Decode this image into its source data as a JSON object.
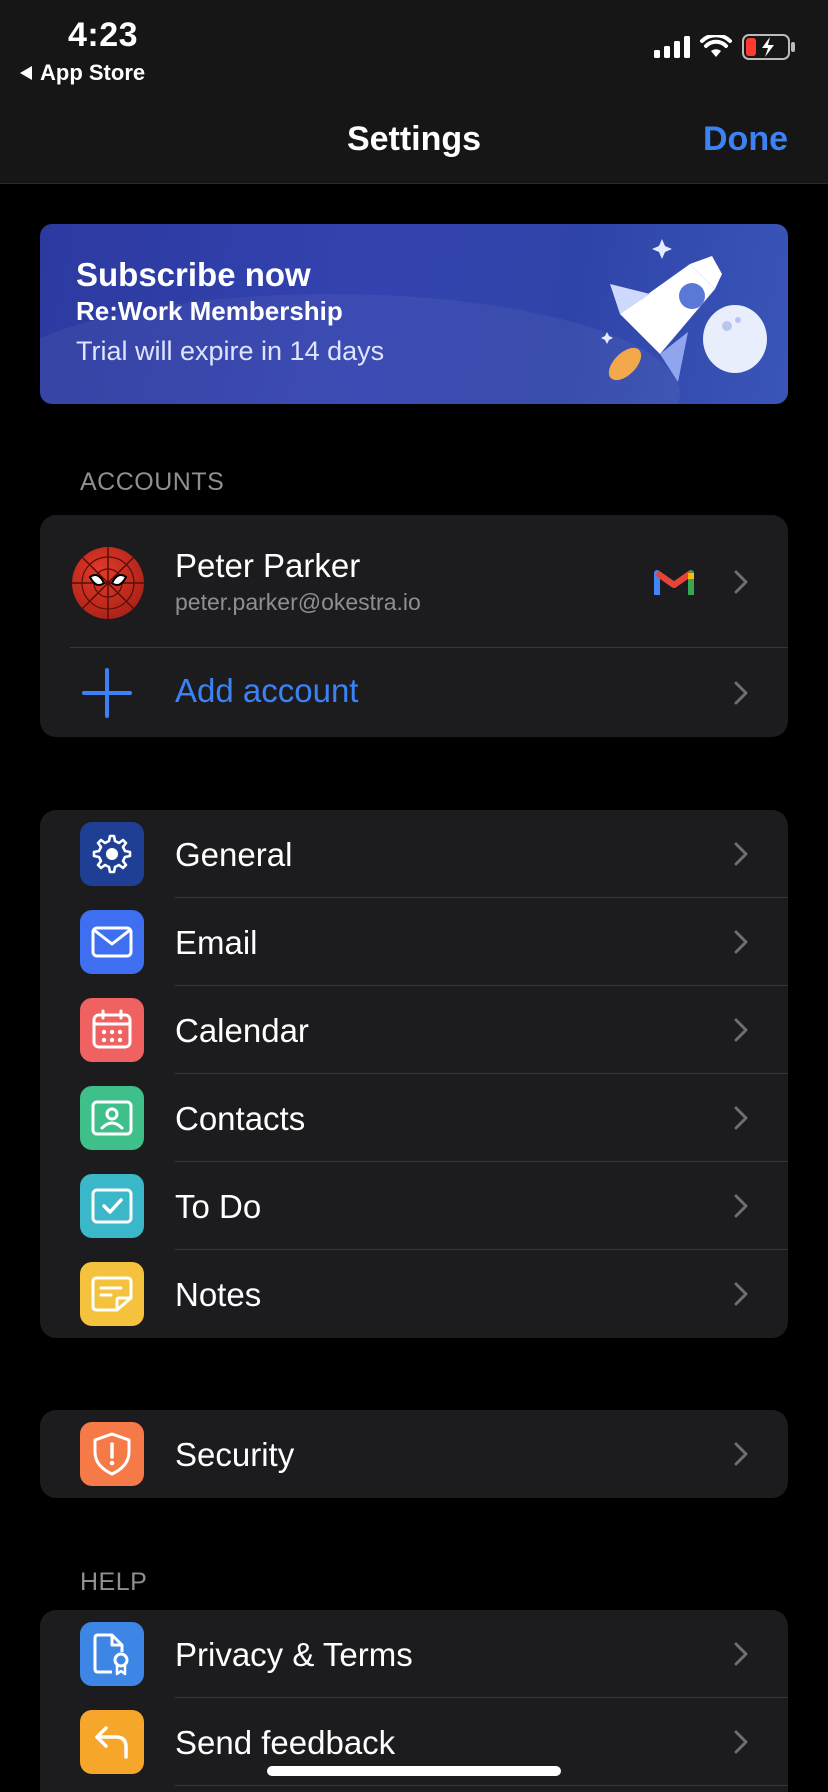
{
  "status_bar": {
    "time": "4:23",
    "back_label": "App Store"
  },
  "nav": {
    "title": "Settings",
    "done_label": "Done"
  },
  "banner": {
    "title": "Subscribe now",
    "subtitle": "Re:Work Membership",
    "note": "Trial will expire in 14 days"
  },
  "accounts": {
    "header": "ACCOUNTS",
    "user": {
      "name": "Peter Parker",
      "email": "peter.parker@okestra.io",
      "provider_icon": "gmail-icon"
    },
    "add_label": "Add account"
  },
  "apps": {
    "items": [
      {
        "label": "General",
        "icon": "gear-icon",
        "color": "#1f3f95"
      },
      {
        "label": "Email",
        "icon": "envelope-icon",
        "color": "#3e6ff0"
      },
      {
        "label": "Calendar",
        "icon": "calendar-icon",
        "color": "#f06262"
      },
      {
        "label": "Contacts",
        "icon": "contact-card-icon",
        "color": "#3fbf8a"
      },
      {
        "label": "To Do",
        "icon": "checkbox-icon",
        "color": "#3ab7c8"
      },
      {
        "label": "Notes",
        "icon": "note-icon",
        "color": "#f5c23e"
      }
    ]
  },
  "security": {
    "label": "Security",
    "icon": "shield-icon",
    "color": "#f57a48"
  },
  "help": {
    "header": "HELP",
    "items": [
      {
        "label": "Privacy & Terms",
        "icon": "document-badge-icon",
        "color": "#3e86e6"
      },
      {
        "label": "Send feedback",
        "icon": "reply-arrow-icon",
        "color": "#f7a62c"
      }
    ]
  },
  "colors": {
    "accent": "#3b82f6",
    "background": "#000000",
    "card": "#1c1c1e"
  }
}
